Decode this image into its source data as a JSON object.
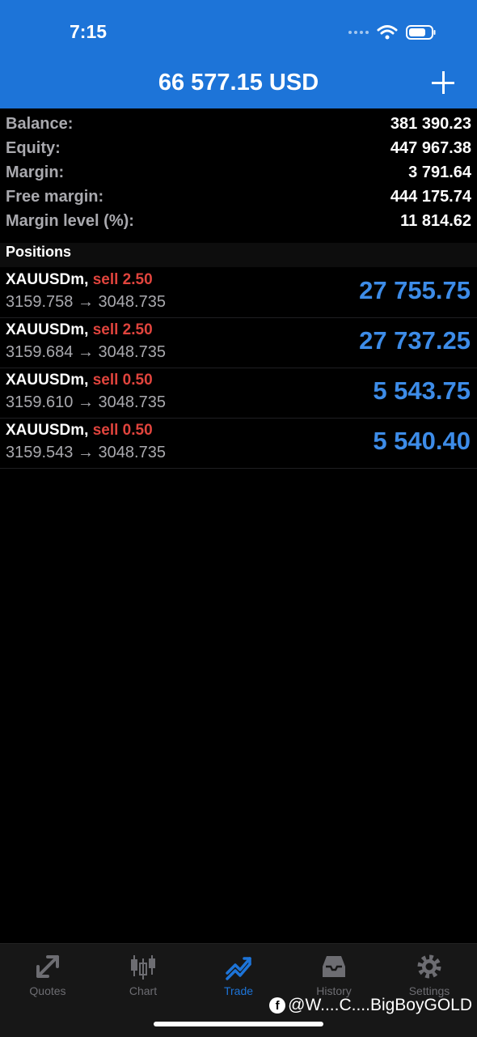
{
  "status_bar": {
    "time": "7:15"
  },
  "header": {
    "title": "66 577.15 USD"
  },
  "summary": [
    {
      "label": "Balance:",
      "value": "381 390.23"
    },
    {
      "label": "Equity:",
      "value": "447 967.38"
    },
    {
      "label": "Margin:",
      "value": "3 791.64"
    },
    {
      "label": "Free margin:",
      "value": "444 175.74"
    },
    {
      "label": "Margin level (%):",
      "value": "11 814.62"
    }
  ],
  "positions_title": "Positions",
  "positions": [
    {
      "symbol": "XAUUSDm,",
      "side": "sell 2.50",
      "prices": "3159.758 → 3048.735",
      "profit": "27 755.75"
    },
    {
      "symbol": "XAUUSDm,",
      "side": "sell 2.50",
      "prices": "3159.684 → 3048.735",
      "profit": "27 737.25"
    },
    {
      "symbol": "XAUUSDm,",
      "side": "sell 0.50",
      "prices": "3159.610 → 3048.735",
      "profit": "5 543.75"
    },
    {
      "symbol": "XAUUSDm,",
      "side": "sell 0.50",
      "prices": "3159.543 → 3048.735",
      "profit": "5 540.40"
    }
  ],
  "tabs": [
    {
      "label": "Quotes",
      "icon": "quotes-icon"
    },
    {
      "label": "Chart",
      "icon": "chart-icon"
    },
    {
      "label": "Trade",
      "icon": "trade-icon",
      "active": true
    },
    {
      "label": "History",
      "icon": "history-icon"
    },
    {
      "label": "Settings",
      "icon": "settings-icon"
    }
  ],
  "watermark": "@W....C....BigBoyGOLD",
  "colors": {
    "accent": "#1d74d8",
    "sell": "#e0443d",
    "profit": "#3d8ce8"
  }
}
